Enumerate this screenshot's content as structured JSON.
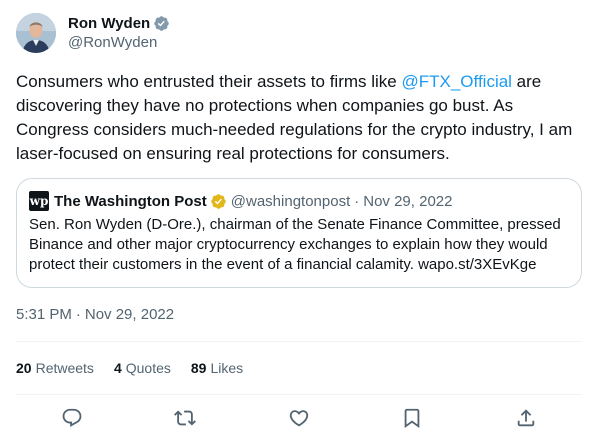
{
  "author": {
    "display_name": "Ron Wyden",
    "handle": "@RonWyden",
    "verified_color": "#1d9bf0"
  },
  "tweet": {
    "text_before": "Consumers who entrusted their assets to firms like ",
    "mention": "@FTX_Official",
    "text_after": " are discovering they have no protections when companies go bust. As Congress considers much-needed regulations for the crypto industry, I am laser-focused on ensuring real protections for consumers."
  },
  "quote": {
    "logo_text": "wp",
    "name": "The Washington Post",
    "badge_color": "#e2b719",
    "handle": "@washingtonpost",
    "separator": "·",
    "date": "Nov 29, 2022",
    "text": "Sen. Ron Wyden (D-Ore.), chairman of the Senate Finance Committee, pressed Binance and other major cryptocurrency exchanges to explain how they would protect their customers in the event of a financial calamity. wapo.st/3XEvKge"
  },
  "timestamp": {
    "time": "5:31 PM",
    "separator": "·",
    "date": "Nov 29, 2022"
  },
  "stats": {
    "retweets_count": "20",
    "retweets_label": "Retweets",
    "quotes_count": "4",
    "quotes_label": "Quotes",
    "likes_count": "89",
    "likes_label": "Likes"
  },
  "actions": {
    "icons": [
      "reply-icon",
      "retweet-icon",
      "like-icon",
      "bookmark-icon",
      "share-icon"
    ],
    "icon_color": "#536471"
  }
}
